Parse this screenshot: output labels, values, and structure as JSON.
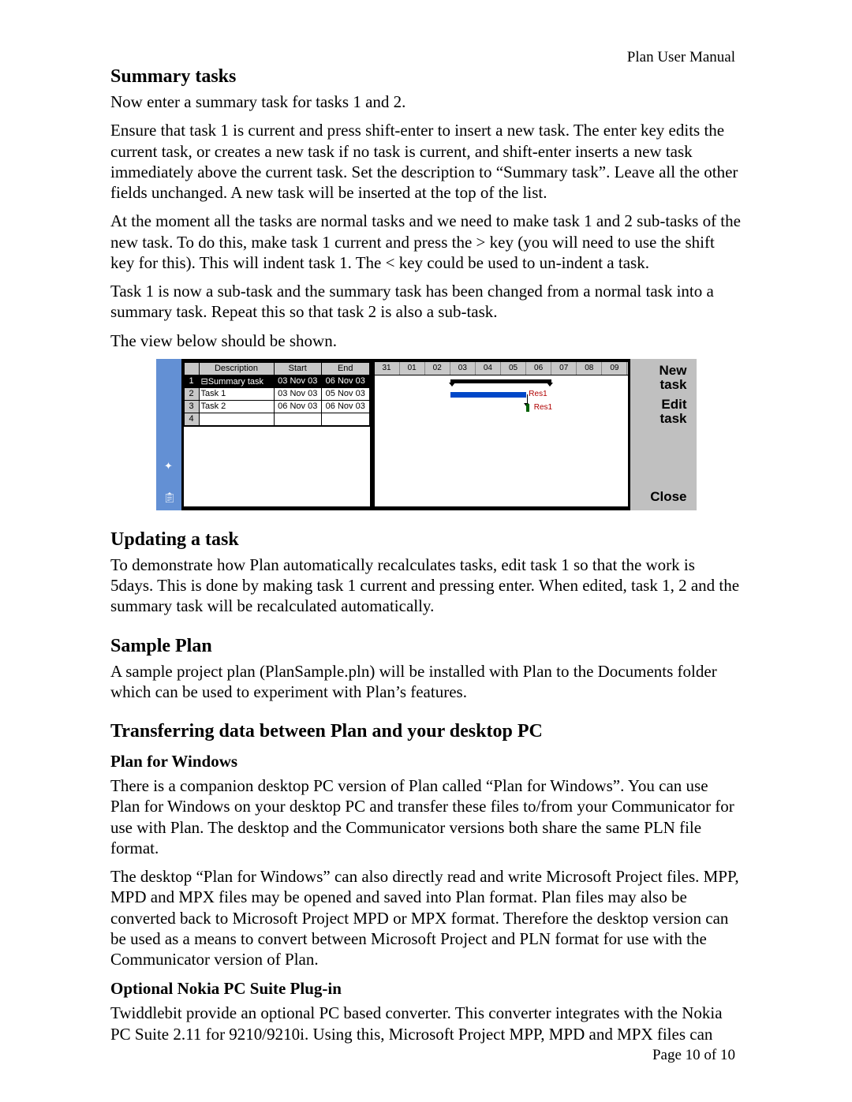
{
  "header": {
    "title": "Plan User Manual"
  },
  "footer": {
    "page_text": "Page 10 of 10"
  },
  "sections": {
    "summary_tasks": {
      "heading": "Summary tasks",
      "p1": "Now enter a summary task for tasks 1 and 2.",
      "p2": "Ensure that task 1 is current and press shift-enter to insert a new task. The enter key edits the current task, or creates a new task if no task is current, and shift-enter inserts a new task immediately above the current task. Set the description to “Summary task”. Leave all the other fields unchanged. A new task will be inserted at the top of the list.",
      "p3": "At the moment all the tasks are normal tasks and we need to make task 1 and 2 sub-tasks of the new task. To do this, make task 1 current and press the > key (you will need to use the shift key for this). This will indent task 1. The < key could be used to un-indent a task.",
      "p4": "Task 1 is now a sub-task and the summary task has been changed from a normal task into a summary task. Repeat this so that task 2 is also a sub-task.",
      "p5": "The view below should be shown."
    },
    "updating": {
      "heading": "Updating a task",
      "p1": "To demonstrate how Plan automatically recalculates tasks, edit task 1 so that the work is 5days. This is done by making task 1 current and pressing enter. When edited, task 1, 2 and the summary task will be recalculated automatically."
    },
    "sample": {
      "heading": "Sample Plan",
      "p1": "A sample project plan (PlanSample.pln) will be installed with Plan to the Documents folder which can be used to experiment with Plan’s features."
    },
    "transfer": {
      "heading": "Transferring data between Plan and your desktop PC",
      "sub1_heading": "Plan for Windows",
      "sub1_p1": "There is a companion desktop PC version of Plan called “Plan for Windows”. You can use Plan for Windows on your desktop PC and transfer these files to/from your Communicator for use with Plan. The desktop and the Communicator versions both share the same PLN file format.",
      "sub1_p2": "The desktop “Plan for Windows” can also directly read and write Microsoft Project files. MPP, MPD and MPX files may be opened and saved into Plan format. Plan files may also be converted back to Microsoft Project MPD or MPX format. Therefore the desktop version can be used as a means to convert between Microsoft Project and PLN format for use with the Communicator version of Plan.",
      "sub2_heading": "Optional Nokia PC Suite Plug-in",
      "sub2_p1": "Twiddlebit provide an optional PC based converter. This converter integrates with the Nokia PC Suite 2.11 for 9210/9210i. Using this, Microsoft Project MPP, MPD and MPX files can"
    }
  },
  "screenshot": {
    "columns": {
      "description": "Description",
      "start": "Start",
      "end": "End"
    },
    "rows": [
      {
        "n": "1",
        "desc": "⊟Summary task",
        "start": "03 Nov 03",
        "end": "06 Nov 03",
        "summary": true
      },
      {
        "n": "2",
        "desc": "   Task 1",
        "start": "03 Nov 03",
        "end": "05 Nov 03",
        "summary": false
      },
      {
        "n": "3",
        "desc": "   Task 2",
        "start": "06 Nov 03",
        "end": "06 Nov 03",
        "summary": false
      },
      {
        "n": "4",
        "desc": "",
        "start": "",
        "end": "",
        "summary": false
      }
    ],
    "timeline_days": [
      "31",
      "01",
      "02",
      "03",
      "04",
      "05",
      "06",
      "07",
      "08",
      "09"
    ],
    "resource_label": "Res1",
    "buttons": {
      "new": "New",
      "task": "task",
      "edit": "Edit",
      "close": "Close"
    }
  }
}
